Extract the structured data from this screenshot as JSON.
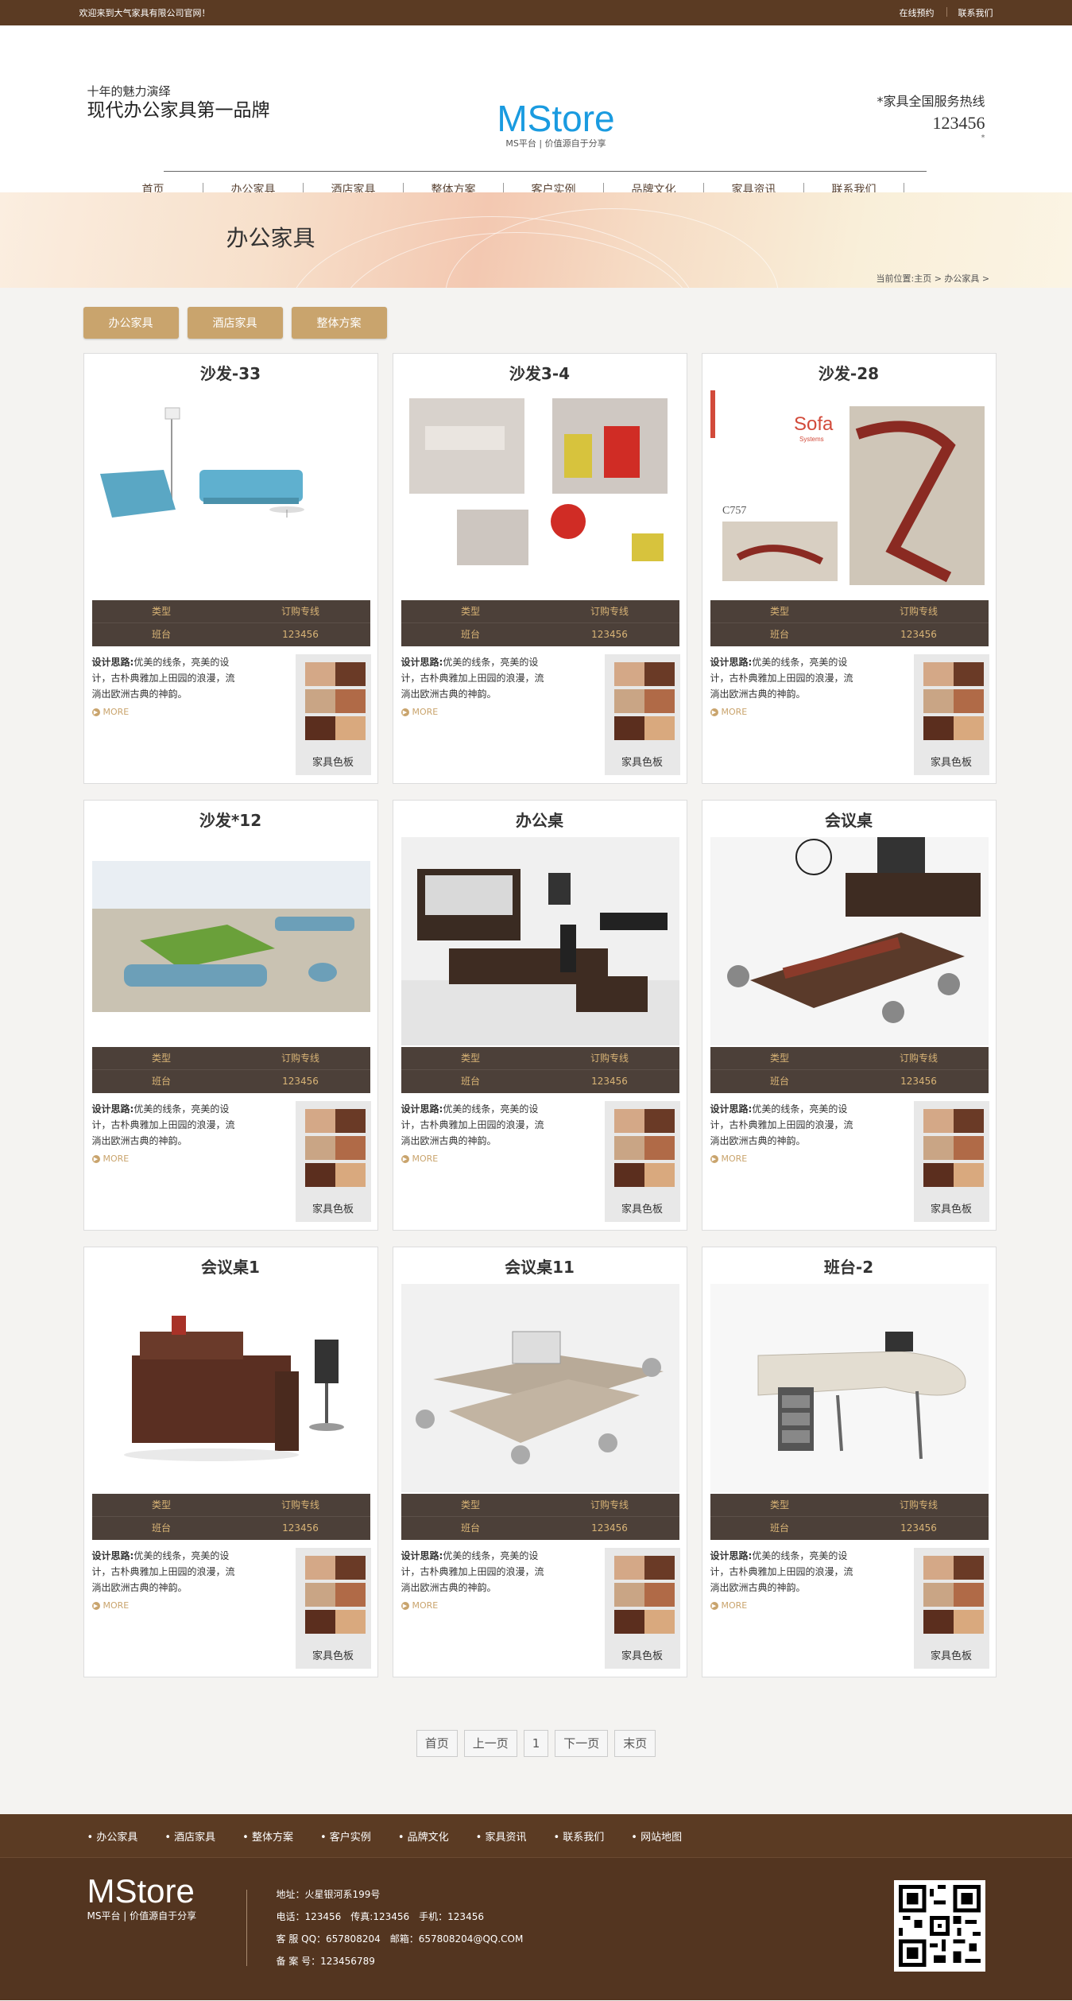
{
  "topbar": {
    "welcome": "欢迎来到大气家具有限公司官网！",
    "links": [
      "在线预约",
      "联系我们"
    ]
  },
  "header": {
    "slogan_line1": "十年的魅力演绎",
    "slogan_line2": "现代办公家具第一品牌",
    "logo_brand": "MStore",
    "logo_tag": "MS平台 | 价值源自于分享",
    "hotline_title": "*家具全国服务热线",
    "hotline_number": "123456",
    "hotline_star": "*"
  },
  "nav": [
    "首页",
    "办公家具",
    "酒店家具",
    "整体方案",
    "客户实例",
    "品牌文化",
    "家具资讯",
    "联系我们"
  ],
  "banner": {
    "title": "办公家具",
    "breadcrumb": "当前位置:主页 > 办公家具 >"
  },
  "categories": [
    "办公家具",
    "酒店家具",
    "整体方案"
  ],
  "card_common": {
    "spec_labels": [
      "类型",
      "订购专线"
    ],
    "spec_values": [
      "班台",
      "123456"
    ],
    "desc_bold": "设计思路:",
    "desc_text": "优美的线条，亮美的设计，古朴典雅加上田园的浪漫，流淌出欧洲古典的神韵。",
    "more": "MORE",
    "swatch_label": "家具色板"
  },
  "products": [
    {
      "title": "沙发-33",
      "image": "sofa-blue-icon"
    },
    {
      "title": "沙发3-4",
      "image": "sofa-catalog-icon"
    },
    {
      "title": "沙发-28",
      "image": "sofa-system-icon"
    },
    {
      "title": "沙发*12",
      "image": "sofa-lounge-icon"
    },
    {
      "title": "办公桌",
      "image": "office-desk-icon"
    },
    {
      "title": "会议桌",
      "image": "meeting-table-icon"
    },
    {
      "title": "会议桌1",
      "image": "reception-desk-icon"
    },
    {
      "title": "会议桌11",
      "image": "workstation-icon"
    },
    {
      "title": "班台-2",
      "image": "curved-desk-icon"
    }
  ],
  "catalog_text": {
    "sofa_word": "Sofa",
    "sofa_sub": "Systems",
    "model": "C757"
  },
  "pager": [
    "首页",
    "上一页",
    "1",
    "下一页",
    "末页"
  ],
  "footer_nav": [
    "办公家具",
    "酒店家具",
    "整体方案",
    "客户实例",
    "品牌文化",
    "家具资讯",
    "联系我们",
    "网站地图"
  ],
  "footer": {
    "brand": "MStore",
    "tag": "MS平台 | 价值源自于分享",
    "address": "地址：火星银河系199号",
    "phones": "电话：123456　传真:123456　手机：123456",
    "qq_email": "客 服 QQ：657808204　邮箱：657808204@QQ.COM",
    "icp": "备 案 号：123456789"
  },
  "colors": {
    "topbar": "#5b3b23",
    "accent_gold": "#c9a46d",
    "spec_bg": "#4c4039",
    "logo_blue": "#1a9be0"
  }
}
